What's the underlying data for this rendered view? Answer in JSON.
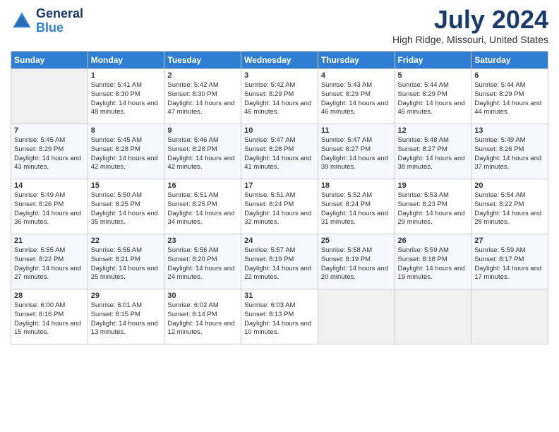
{
  "header": {
    "logo_line1": "General",
    "logo_line2": "Blue",
    "month": "July 2024",
    "location": "High Ridge, Missouri, United States"
  },
  "weekdays": [
    "Sunday",
    "Monday",
    "Tuesday",
    "Wednesday",
    "Thursday",
    "Friday",
    "Saturday"
  ],
  "weeks": [
    [
      {
        "num": "",
        "empty": true
      },
      {
        "num": "1",
        "sunrise": "Sunrise: 5:41 AM",
        "sunset": "Sunset: 8:30 PM",
        "daylight": "Daylight: 14 hours and 48 minutes."
      },
      {
        "num": "2",
        "sunrise": "Sunrise: 5:42 AM",
        "sunset": "Sunset: 8:30 PM",
        "daylight": "Daylight: 14 hours and 47 minutes."
      },
      {
        "num": "3",
        "sunrise": "Sunrise: 5:42 AM",
        "sunset": "Sunset: 8:29 PM",
        "daylight": "Daylight: 14 hours and 46 minutes."
      },
      {
        "num": "4",
        "sunrise": "Sunrise: 5:43 AM",
        "sunset": "Sunset: 8:29 PM",
        "daylight": "Daylight: 14 hours and 46 minutes."
      },
      {
        "num": "5",
        "sunrise": "Sunrise: 5:44 AM",
        "sunset": "Sunset: 8:29 PM",
        "daylight": "Daylight: 14 hours and 45 minutes."
      },
      {
        "num": "6",
        "sunrise": "Sunrise: 5:44 AM",
        "sunset": "Sunset: 8:29 PM",
        "daylight": "Daylight: 14 hours and 44 minutes."
      }
    ],
    [
      {
        "num": "7",
        "sunrise": "Sunrise: 5:45 AM",
        "sunset": "Sunset: 8:29 PM",
        "daylight": "Daylight: 14 hours and 43 minutes."
      },
      {
        "num": "8",
        "sunrise": "Sunrise: 5:45 AM",
        "sunset": "Sunset: 8:28 PM",
        "daylight": "Daylight: 14 hours and 42 minutes."
      },
      {
        "num": "9",
        "sunrise": "Sunrise: 5:46 AM",
        "sunset": "Sunset: 8:28 PM",
        "daylight": "Daylight: 14 hours and 42 minutes."
      },
      {
        "num": "10",
        "sunrise": "Sunrise: 5:47 AM",
        "sunset": "Sunset: 8:28 PM",
        "daylight": "Daylight: 14 hours and 41 minutes."
      },
      {
        "num": "11",
        "sunrise": "Sunrise: 5:47 AM",
        "sunset": "Sunset: 8:27 PM",
        "daylight": "Daylight: 14 hours and 39 minutes."
      },
      {
        "num": "12",
        "sunrise": "Sunrise: 5:48 AM",
        "sunset": "Sunset: 8:27 PM",
        "daylight": "Daylight: 14 hours and 38 minutes."
      },
      {
        "num": "13",
        "sunrise": "Sunrise: 5:49 AM",
        "sunset": "Sunset: 8:26 PM",
        "daylight": "Daylight: 14 hours and 37 minutes."
      }
    ],
    [
      {
        "num": "14",
        "sunrise": "Sunrise: 5:49 AM",
        "sunset": "Sunset: 8:26 PM",
        "daylight": "Daylight: 14 hours and 36 minutes."
      },
      {
        "num": "15",
        "sunrise": "Sunrise: 5:50 AM",
        "sunset": "Sunset: 8:25 PM",
        "daylight": "Daylight: 14 hours and 35 minutes."
      },
      {
        "num": "16",
        "sunrise": "Sunrise: 5:51 AM",
        "sunset": "Sunset: 8:25 PM",
        "daylight": "Daylight: 14 hours and 34 minutes."
      },
      {
        "num": "17",
        "sunrise": "Sunrise: 5:51 AM",
        "sunset": "Sunset: 8:24 PM",
        "daylight": "Daylight: 14 hours and 32 minutes."
      },
      {
        "num": "18",
        "sunrise": "Sunrise: 5:52 AM",
        "sunset": "Sunset: 8:24 PM",
        "daylight": "Daylight: 14 hours and 31 minutes."
      },
      {
        "num": "19",
        "sunrise": "Sunrise: 5:53 AM",
        "sunset": "Sunset: 8:23 PM",
        "daylight": "Daylight: 14 hours and 29 minutes."
      },
      {
        "num": "20",
        "sunrise": "Sunrise: 5:54 AM",
        "sunset": "Sunset: 8:22 PM",
        "daylight": "Daylight: 14 hours and 28 minutes."
      }
    ],
    [
      {
        "num": "21",
        "sunrise": "Sunrise: 5:55 AM",
        "sunset": "Sunset: 8:22 PM",
        "daylight": "Daylight: 14 hours and 27 minutes."
      },
      {
        "num": "22",
        "sunrise": "Sunrise: 5:55 AM",
        "sunset": "Sunset: 8:21 PM",
        "daylight": "Daylight: 14 hours and 25 minutes."
      },
      {
        "num": "23",
        "sunrise": "Sunrise: 5:56 AM",
        "sunset": "Sunset: 8:20 PM",
        "daylight": "Daylight: 14 hours and 24 minutes."
      },
      {
        "num": "24",
        "sunrise": "Sunrise: 5:57 AM",
        "sunset": "Sunset: 8:19 PM",
        "daylight": "Daylight: 14 hours and 22 minutes."
      },
      {
        "num": "25",
        "sunrise": "Sunrise: 5:58 AM",
        "sunset": "Sunset: 8:19 PM",
        "daylight": "Daylight: 14 hours and 20 minutes."
      },
      {
        "num": "26",
        "sunrise": "Sunrise: 5:59 AM",
        "sunset": "Sunset: 8:18 PM",
        "daylight": "Daylight: 14 hours and 19 minutes."
      },
      {
        "num": "27",
        "sunrise": "Sunrise: 5:59 AM",
        "sunset": "Sunset: 8:17 PM",
        "daylight": "Daylight: 14 hours and 17 minutes."
      }
    ],
    [
      {
        "num": "28",
        "sunrise": "Sunrise: 6:00 AM",
        "sunset": "Sunset: 8:16 PM",
        "daylight": "Daylight: 14 hours and 15 minutes."
      },
      {
        "num": "29",
        "sunrise": "Sunrise: 6:01 AM",
        "sunset": "Sunset: 8:15 PM",
        "daylight": "Daylight: 14 hours and 13 minutes."
      },
      {
        "num": "30",
        "sunrise": "Sunrise: 6:02 AM",
        "sunset": "Sunset: 8:14 PM",
        "daylight": "Daylight: 14 hours and 12 minutes."
      },
      {
        "num": "31",
        "sunrise": "Sunrise: 6:03 AM",
        "sunset": "Sunset: 8:13 PM",
        "daylight": "Daylight: 14 hours and 10 minutes."
      },
      {
        "num": "",
        "empty": true
      },
      {
        "num": "",
        "empty": true
      },
      {
        "num": "",
        "empty": true
      }
    ]
  ]
}
